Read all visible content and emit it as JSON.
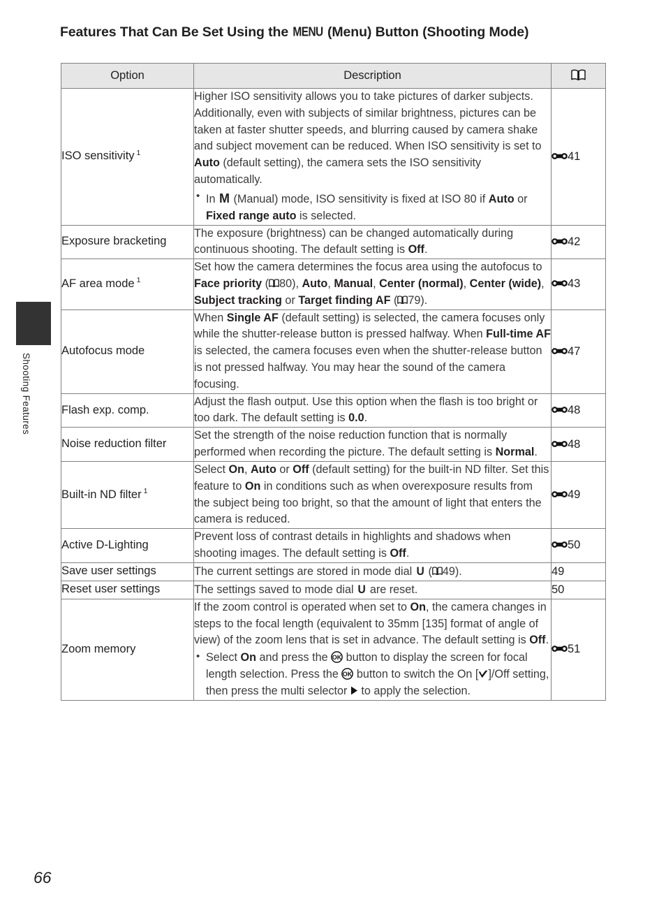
{
  "page": {
    "number": "66",
    "title_before_menu": "Features That Can Be Set Using the ",
    "menu_glyph_label": "MENU",
    "title_after_menu": " (Menu) Button (Shooting Mode)"
  },
  "sidebar": {
    "chapter_label": "Shooting Features",
    "tab_color": "#333333"
  },
  "table": {
    "headers": {
      "option": "Option",
      "description": "Description",
      "reference": "book-icon"
    },
    "rows": [
      {
        "option": "ISO sensitivity",
        "option_footnote": "1",
        "reference": "41",
        "reference_icon": "reference-section-icon",
        "description_text": "Higher ISO sensitivity allows you to take pictures of darker subjects. Additionally, even with subjects of similar brightness, pictures can be taken at faster shutter speeds, and blurring caused by camera shake and subject movement can be reduced. When ISO sensitivity is set to Auto (default setting), the camera sets the ISO sensitivity automatically.",
        "bullet_text": "In M (Manual) mode, ISO sensitivity is fixed at ISO 80 if Auto or Fixed range auto is selected."
      },
      {
        "option": "Exposure bracketing",
        "reference": "42",
        "reference_icon": "reference-section-icon",
        "description_text": "The exposure (brightness) can be changed automatically during continuous shooting. The default setting is Off."
      },
      {
        "option": "AF area mode",
        "option_footnote": "1",
        "reference": "43",
        "reference_icon": "reference-section-icon",
        "description_text": "Set how the camera determines the focus area using the autofocus to Face priority (80), Auto, Manual, Center (normal), Center (wide), Subject tracking or Target finding AF (79)."
      },
      {
        "option": "Autofocus mode",
        "reference": "47",
        "reference_icon": "reference-section-icon",
        "description_text": "When Single AF (default setting) is selected, the camera focuses only while the shutter-release button is pressed halfway. When Full-time AF is selected, the camera focuses even when the shutter-release button is not pressed halfway. You may hear the sound of the camera focusing."
      },
      {
        "option": "Flash exp. comp.",
        "reference": "48",
        "reference_icon": "reference-section-icon",
        "description_text": "Adjust the flash output. Use this option when the flash is too bright or too dark. The default setting is 0.0."
      },
      {
        "option": "Noise reduction filter",
        "reference": "48",
        "reference_icon": "reference-section-icon",
        "description_text": "Set the strength of the noise reduction function that is normally performed when recording the picture. The default setting is Normal."
      },
      {
        "option": "Built-in ND filter",
        "option_footnote": "1",
        "reference": "49",
        "reference_icon": "reference-section-icon",
        "description_text": "Select On, Auto or Off (default setting) for the built-in ND filter. Set this feature to On in conditions such as when overexposure results from the subject being too bright, so that the amount of light that enters the camera is reduced."
      },
      {
        "option": "Active D-Lighting",
        "reference": "50",
        "reference_icon": "reference-section-icon",
        "description_text": "Prevent loss of contrast details in highlights and shadows when shooting images. The default setting is Off."
      },
      {
        "option": "Save user settings",
        "reference": "49",
        "reference_icon": "none",
        "description_text": "The current settings are stored in mode dial U (49)."
      },
      {
        "option": "Reset user settings",
        "reference": "50",
        "reference_icon": "none",
        "description_text": "The settings saved to mode dial U are reset."
      },
      {
        "option": "Zoom memory",
        "reference": "51",
        "reference_icon": "reference-section-icon",
        "description_text": "If the zoom control is operated when set to On, the camera changes in steps to the focal length (equivalent to 35mm [135] format of angle of view) of the zoom lens that is set in advance. The default setting is Off.",
        "bullet_text": "Select On and press the OK button to display the screen for focal length selection. Press the OK button to switch the On [✔]/Off setting, then press the multi selector ▶ to apply the selection."
      }
    ],
    "inline_page_refs": {
      "face_priority": "80",
      "target_finding_af": "79",
      "save_user_settings": "49"
    },
    "emphasis_terms": [
      "Auto",
      "Fixed range auto",
      "Off",
      "Face priority",
      "Manual",
      "Center (normal)",
      "Center (wide)",
      "Subject tracking",
      "Target finding AF",
      "Single AF",
      "Full-time AF",
      "0.0",
      "Normal",
      "On"
    ]
  }
}
